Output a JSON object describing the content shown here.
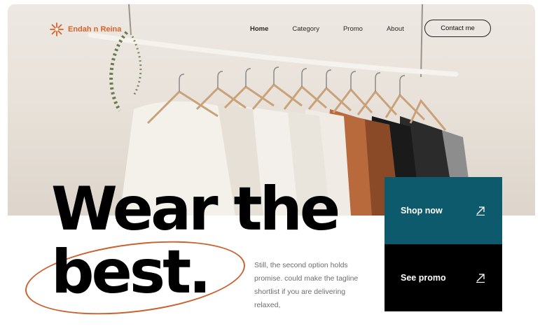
{
  "brand": {
    "name": "Endah n Reina",
    "accent": "#d9622b"
  },
  "nav": {
    "items": [
      {
        "label": "Home",
        "active": true
      },
      {
        "label": "Category",
        "active": false
      },
      {
        "label": "Promo",
        "active": false
      },
      {
        "label": "About",
        "active": false
      }
    ],
    "contact_label": "Contact me"
  },
  "hero": {
    "headline_line1": "Wear the",
    "headline_line2": "best.",
    "description": "Still, the second option holds promise. could make the tagline shortlist if you are delivering relaxed,"
  },
  "cta": {
    "shop_label": "Shop now",
    "promo_label": "See promo",
    "shop_color": "#0c5a6c",
    "promo_color": "#000000"
  },
  "icons": [
    "sunburst-logo-icon",
    "arrow-up-right-icon"
  ]
}
